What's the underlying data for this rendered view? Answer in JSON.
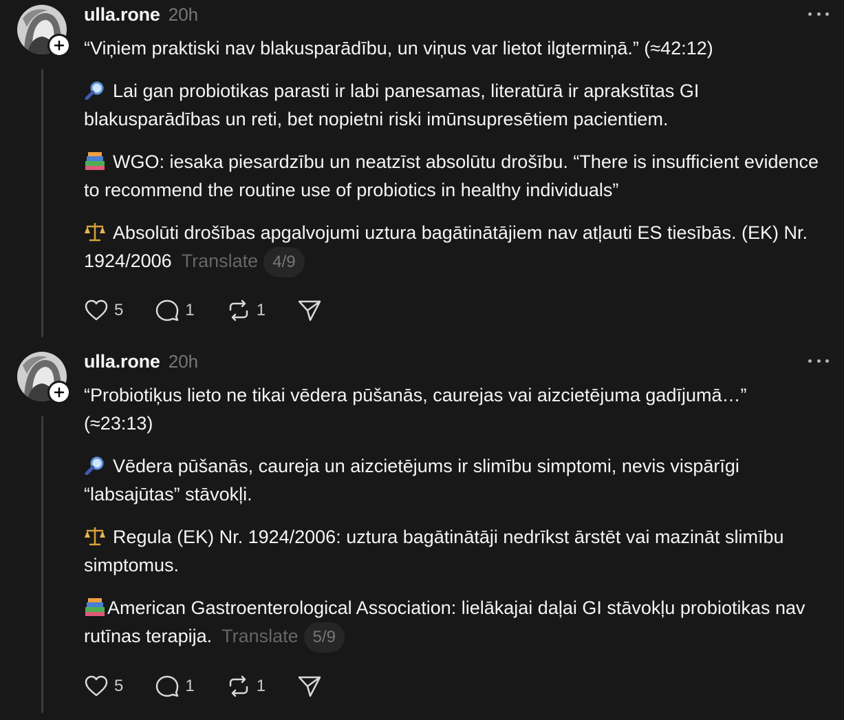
{
  "posts": [
    {
      "username": "ulla.rone",
      "time": "20h",
      "line1": "“Viņiem praktiski nav blakusparādību, un viņus var lietot ilgtermiņā.” (≈42:12)",
      "line2": "Lai gan probiotikas parasti ir labi panesamas, literatūrā ir aprakstītas GI blakusparādības un reti, bet nopietni riski imūnsupresētiem pacientiem.",
      "line3": "WGO: iesaka piesardzību un neatzīst absolūtu drošību. “There is insufficient evidence to recommend the routine use of probiotics in healthy individuals”",
      "line4": "Absolūti drošības apgalvojumi uztura bagātinātājiem nav atļauti ES tiesībās. (EK) Nr. 1924/2006",
      "translate": "Translate",
      "pager": "4/9",
      "likes": "5",
      "replies": "1",
      "reposts": "1"
    },
    {
      "username": "ulla.rone",
      "time": "20h",
      "line1": "“Probiotiķus lieto ne tikai vēdera pūšanās, caurejas vai aizcietējuma gadījumā…” (≈23:13)",
      "line2": "Vēdera pūšanās, caureja un aizcietējums ir slimību simptomi, nevis vispārīgi “labsajūtas” stāvokļi.",
      "line3": "Regula (EK) Nr. 1924/2006: uztura bagātinātāji nedrīkst ārstēt vai mazināt slimību simptomus.",
      "line4": "American Gastroenterological Association: lielākajai daļai GI stāvokļu probiotikas nav rutīnas terapija.",
      "translate": "Translate",
      "pager": "5/9",
      "likes": "5",
      "replies": "1",
      "reposts": "1"
    }
  ],
  "icons": {
    "magnifier": "magnifying-glass-icon",
    "books": "books-icon",
    "scales": "balance-scale-icon"
  },
  "colors": {
    "background": "#181818",
    "text": "#f3f5f7",
    "muted": "#777777"
  }
}
